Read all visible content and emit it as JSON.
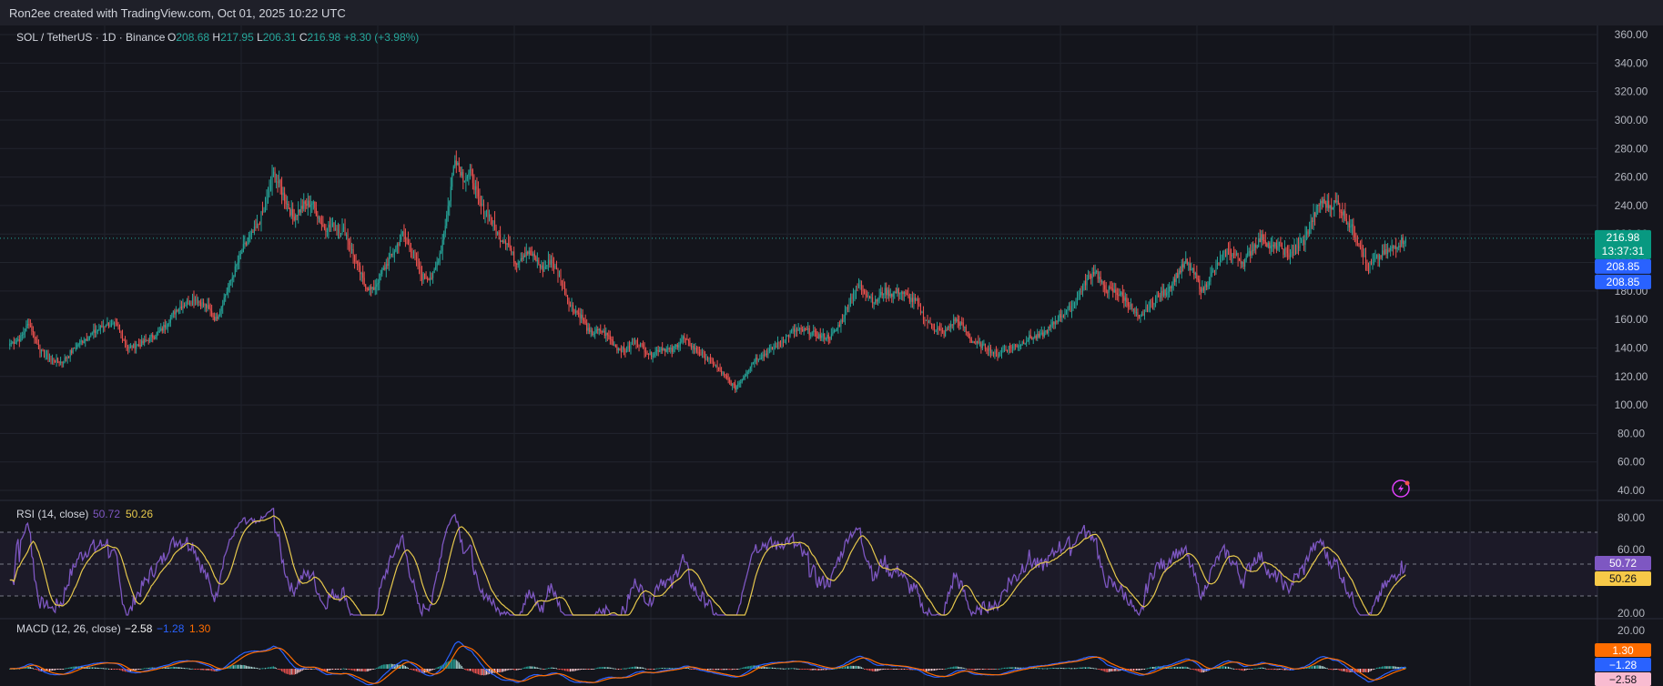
{
  "header": {
    "attribution": "Ron2ee created with TradingView.com, Oct 01, 2025 10:22 UTC"
  },
  "colors": {
    "up": "#26a69a",
    "down": "#ef5350",
    "bg": "#14151c",
    "grid": "#262933",
    "rsi": "#7e57c2",
    "rsi_ma": "#e6c84c",
    "macd": "#2962ff",
    "signal": "#ff6d00"
  },
  "symbol": {
    "name": "SOL / TetherUS · 1D · Binance",
    "o_label": "O",
    "o": "208.68",
    "h_label": "H",
    "h": "217.95",
    "l_label": "L",
    "l": "206.31",
    "c_label": "C",
    "c": "216.98",
    "change": "+8.30 (+3.98%)"
  },
  "price_tags": {
    "last": "216.98",
    "countdown": "13:37:31",
    "tag2": "208.85",
    "tag3": "208.85"
  },
  "rsi": {
    "title": "RSI (14, close)",
    "value": "50.72",
    "ma": "50.26",
    "axis": [
      "80.00",
      "60.00",
      "20.00"
    ]
  },
  "macd": {
    "title": "MACD (12, 26, close)",
    "hist": "−2.58",
    "macd": "−1.28",
    "signal": "1.30",
    "axis": [
      "20.00"
    ]
  },
  "chart_data": {
    "type": "candlestick",
    "ylim": [
      40,
      360
    ],
    "y_ticks": [
      "360.00",
      "340.00",
      "320.00",
      "300.00",
      "280.00",
      "260.00",
      "240.00",
      "220.00",
      "200.00",
      "180.00",
      "160.00",
      "140.00",
      "120.00",
      "100.00",
      "80.00",
      "60.00",
      "40.00"
    ],
    "close_anchors": [
      [
        0,
        143
      ],
      [
        8,
        147
      ],
      [
        14,
        158
      ],
      [
        22,
        138
      ],
      [
        30,
        132
      ],
      [
        38,
        130
      ],
      [
        50,
        143
      ],
      [
        60,
        150
      ],
      [
        70,
        157
      ],
      [
        78,
        155
      ],
      [
        86,
        140
      ],
      [
        96,
        143
      ],
      [
        110,
        152
      ],
      [
        122,
        168
      ],
      [
        134,
        175
      ],
      [
        144,
        168
      ],
      [
        150,
        160
      ],
      [
        160,
        185
      ],
      [
        170,
        210
      ],
      [
        180,
        225
      ],
      [
        186,
        240
      ],
      [
        192,
        262
      ],
      [
        198,
        250
      ],
      [
        206,
        232
      ],
      [
        214,
        240
      ],
      [
        220,
        242
      ],
      [
        228,
        225
      ],
      [
        236,
        225
      ],
      [
        244,
        222
      ],
      [
        250,
        205
      ],
      [
        258,
        185
      ],
      [
        264,
        180
      ],
      [
        272,
        195
      ],
      [
        278,
        205
      ],
      [
        286,
        220
      ],
      [
        292,
        210
      ],
      [
        300,
        190
      ],
      [
        308,
        190
      ],
      [
        314,
        210
      ],
      [
        320,
        245
      ],
      [
        324,
        275
      ],
      [
        330,
        260
      ],
      [
        336,
        262
      ],
      [
        342,
        240
      ],
      [
        348,
        235
      ],
      [
        356,
        218
      ],
      [
        362,
        215
      ],
      [
        368,
        200
      ],
      [
        376,
        208
      ],
      [
        382,
        203
      ],
      [
        388,
        195
      ],
      [
        394,
        202
      ],
      [
        400,
        190
      ],
      [
        408,
        170
      ],
      [
        416,
        162
      ],
      [
        422,
        150
      ],
      [
        430,
        152
      ],
      [
        436,
        148
      ],
      [
        442,
        140
      ],
      [
        448,
        138
      ],
      [
        456,
        145
      ],
      [
        466,
        135
      ],
      [
        474,
        140
      ],
      [
        482,
        138
      ],
      [
        490,
        147
      ],
      [
        500,
        138
      ],
      [
        508,
        133
      ],
      [
        516,
        125
      ],
      [
        522,
        118
      ],
      [
        528,
        112
      ],
      [
        534,
        120
      ],
      [
        542,
        132
      ],
      [
        550,
        136
      ],
      [
        560,
        143
      ],
      [
        570,
        152
      ],
      [
        580,
        152
      ],
      [
        590,
        148
      ],
      [
        598,
        148
      ],
      [
        606,
        160
      ],
      [
        612,
        175
      ],
      [
        618,
        184
      ],
      [
        624,
        178
      ],
      [
        630,
        172
      ],
      [
        636,
        180
      ],
      [
        642,
        178
      ],
      [
        648,
        180
      ],
      [
        654,
        175
      ],
      [
        660,
        172
      ],
      [
        666,
        160
      ],
      [
        672,
        155
      ],
      [
        680,
        150
      ],
      [
        688,
        160
      ],
      [
        694,
        155
      ],
      [
        700,
        145
      ],
      [
        706,
        142
      ],
      [
        712,
        140
      ],
      [
        718,
        135
      ],
      [
        726,
        140
      ],
      [
        734,
        142
      ],
      [
        742,
        147
      ],
      [
        750,
        148
      ],
      [
        758,
        155
      ],
      [
        764,
        162
      ],
      [
        772,
        168
      ],
      [
        778,
        178
      ],
      [
        784,
        188
      ],
      [
        790,
        195
      ],
      [
        796,
        182
      ],
      [
        802,
        180
      ],
      [
        808,
        178
      ],
      [
        814,
        172
      ],
      [
        822,
        160
      ],
      [
        828,
        168
      ],
      [
        834,
        175
      ],
      [
        842,
        180
      ],
      [
        850,
        192
      ],
      [
        856,
        200
      ],
      [
        862,
        192
      ],
      [
        868,
        180
      ],
      [
        874,
        190
      ],
      [
        880,
        200
      ],
      [
        886,
        208
      ],
      [
        892,
        205
      ],
      [
        898,
        200
      ],
      [
        906,
        212
      ],
      [
        912,
        218
      ],
      [
        918,
        210
      ],
      [
        924,
        212
      ],
      [
        930,
        205
      ],
      [
        936,
        210
      ],
      [
        942,
        215
      ],
      [
        948,
        230
      ],
      [
        954,
        243
      ],
      [
        960,
        240
      ],
      [
        966,
        242
      ],
      [
        972,
        232
      ],
      [
        978,
        222
      ],
      [
        984,
        210
      ],
      [
        988,
        195
      ],
      [
        992,
        200
      ],
      [
        998,
        205
      ],
      [
        1004,
        208
      ],
      [
        1010,
        213
      ],
      [
        1016,
        217
      ]
    ]
  }
}
